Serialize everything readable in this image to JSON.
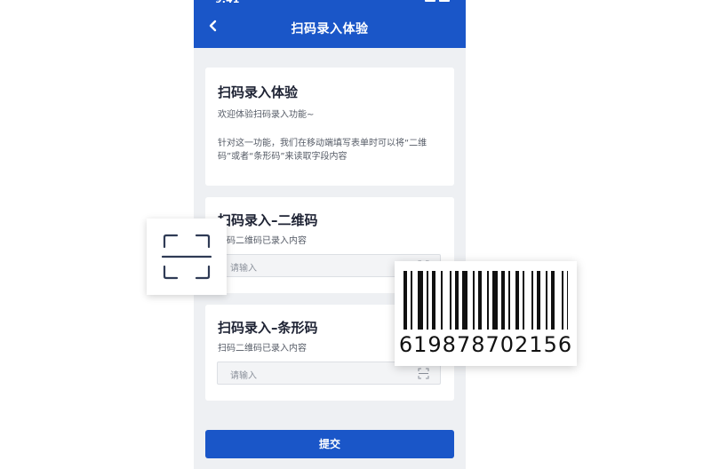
{
  "header": {
    "title": "扫码录入体验",
    "back_icon": "chevron-left-icon"
  },
  "intro_card": {
    "title": "扫码录入体验",
    "welcome": "欢迎体验扫码录入功能~",
    "description": "针对这一功能，我们在移动端填写表单时可以将“二维码”或者“条形码”来读取字段内容"
  },
  "qr_card": {
    "title": "扫码录入–二维码",
    "hint": "扫码二维码已录入内容",
    "input_placeholder": "请输入"
  },
  "barcode_card": {
    "title": "扫码录入–条形码",
    "hint": "扫码二维码已录入内容",
    "input_placeholder": "请输入"
  },
  "submit_label": "提交",
  "overlay": {
    "barcode_number": "619878702156",
    "scan_icon": "scan-frame-icon"
  },
  "colors": {
    "primary": "#1a56c8",
    "background": "#eef0f3",
    "icon": "#2f3b55"
  }
}
